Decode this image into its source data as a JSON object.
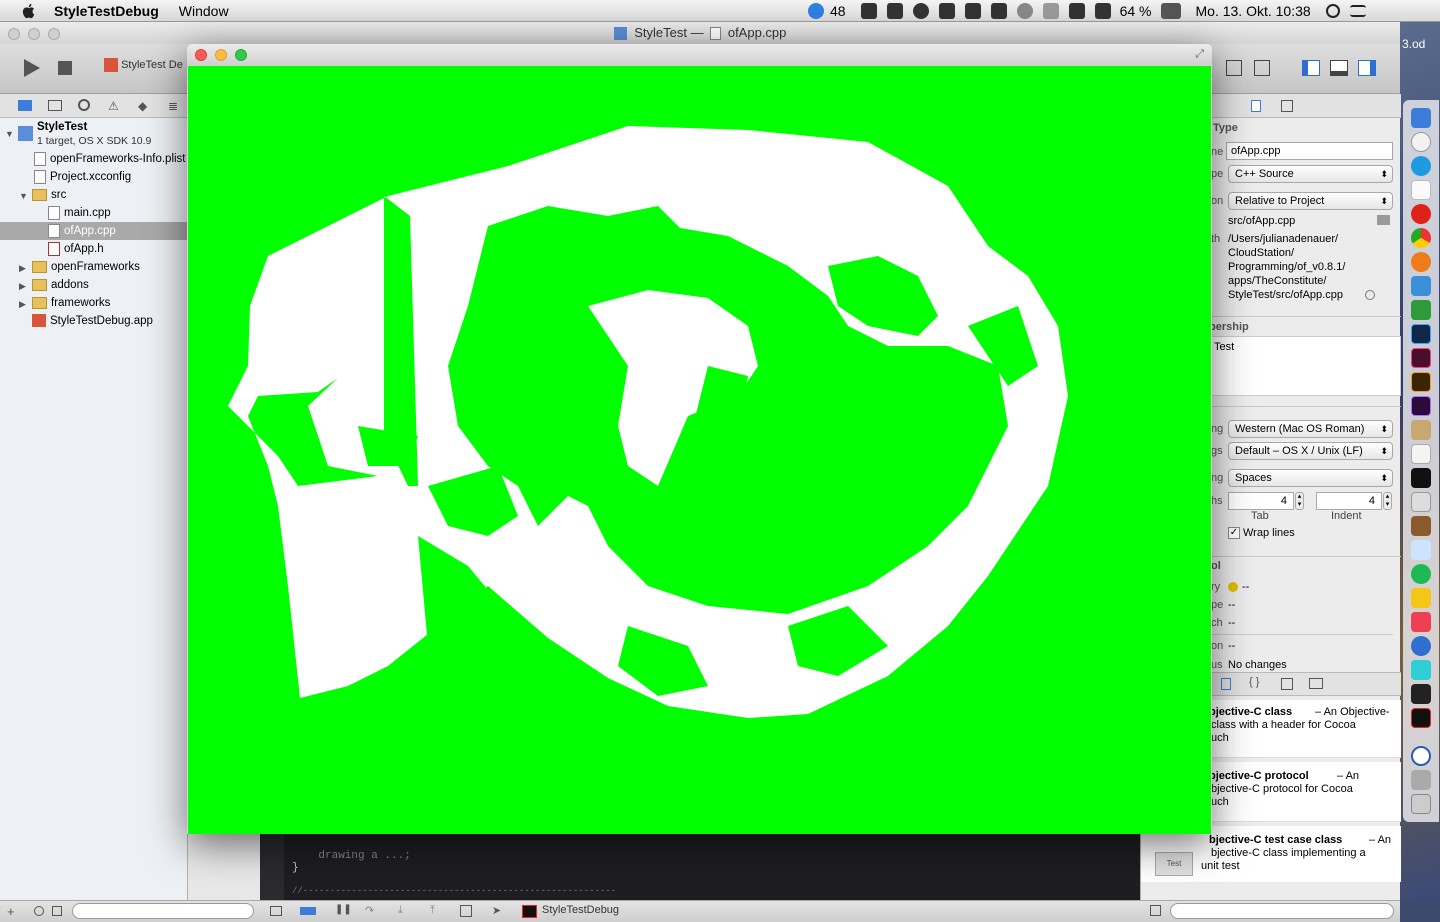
{
  "menubar": {
    "app_name": "StyleTestDebug",
    "items": [
      "Window"
    ],
    "status": {
      "badge_count": "48",
      "battery": "64 %",
      "datetime": "Mo. 13. Okt.  10:38"
    }
  },
  "xcode": {
    "title_project": "StyleTest",
    "title_sep": "—",
    "title_file": "ofApp.cpp",
    "scheme_label": "StyleTest De"
  },
  "navigator": {
    "project_name": "StyleTest",
    "project_sub": "1 target, OS X SDK 10.9",
    "items": [
      {
        "label": "openFrameworks-Info.plist"
      },
      {
        "label": "Project.xcconfig"
      },
      {
        "label": "src"
      },
      {
        "label": "main.cpp"
      },
      {
        "label": "ofApp.cpp"
      },
      {
        "label": "ofApp.h"
      },
      {
        "label": "openFrameworks"
      },
      {
        "label": "addons"
      },
      {
        "label": "frameworks"
      },
      {
        "label": "StyleTestDebug.app"
      }
    ]
  },
  "editor": {
    "lines": [
      "    drawing a ...;",
      "}",
      "",
      "//----------------------------------------------------------"
    ]
  },
  "utilities": {
    "identity_header": "Type",
    "name_label": "ne",
    "name_value": "ofApp.cpp",
    "type_label": "pe",
    "type_value": "C++ Source",
    "location_label": "on",
    "location_value": "Relative to Project",
    "relpath": "src/ofApp.cpp",
    "fullpath_label": "th",
    "fullpath_lines": [
      "/Users/julianadenauer/",
      "CloudStation/",
      "Programming/of_v0.8.1/",
      "apps/TheConstitute/",
      "StyleTest/src/ofApp.cpp"
    ],
    "membership_header": "bership",
    "membership_item": "Test",
    "encoding_label": "ng",
    "encoding_value": "Western (Mac OS Roman)",
    "endings_label": "gs",
    "endings_value": "Default – OS X / Unix (LF)",
    "indent_label": "ng",
    "indent_value": "Spaces",
    "widths_label": "hs",
    "tab_value": "4",
    "indent_width_value": "4",
    "tab_caption": "Tab",
    "indent_caption": "Indent",
    "wrap_label": "Wrap lines",
    "sc_header": "ol",
    "sc_rows": [
      {
        "label": "ry",
        "value": "--"
      },
      {
        "label": "pe",
        "value": "--"
      },
      {
        "label": "ch",
        "value": "--"
      },
      {
        "label": "on",
        "value": "--"
      },
      {
        "label": "us",
        "value": "No changes"
      }
    ],
    "templates": [
      {
        "title": "bjective-C class",
        "desc_lines": [
          "– An Objective-",
          "class with a header for Cocoa",
          "uch"
        ]
      },
      {
        "title": "bjective-C protocol",
        "desc_lines": [
          "– An",
          "bjective-C protocol for Cocoa",
          "uch"
        ]
      },
      {
        "title": "bjective-C test case class",
        "desc_lines": [
          "– An",
          "bjective-C class implementing a",
          "unit test"
        ]
      }
    ],
    "template_icon_text": "Test"
  },
  "debugbar": {
    "target": "StyleTestDebug"
  },
  "desktop": {
    "label": "3.od"
  },
  "colors": {
    "canvas": "#00ff00",
    "selection": "#4a89dc"
  }
}
